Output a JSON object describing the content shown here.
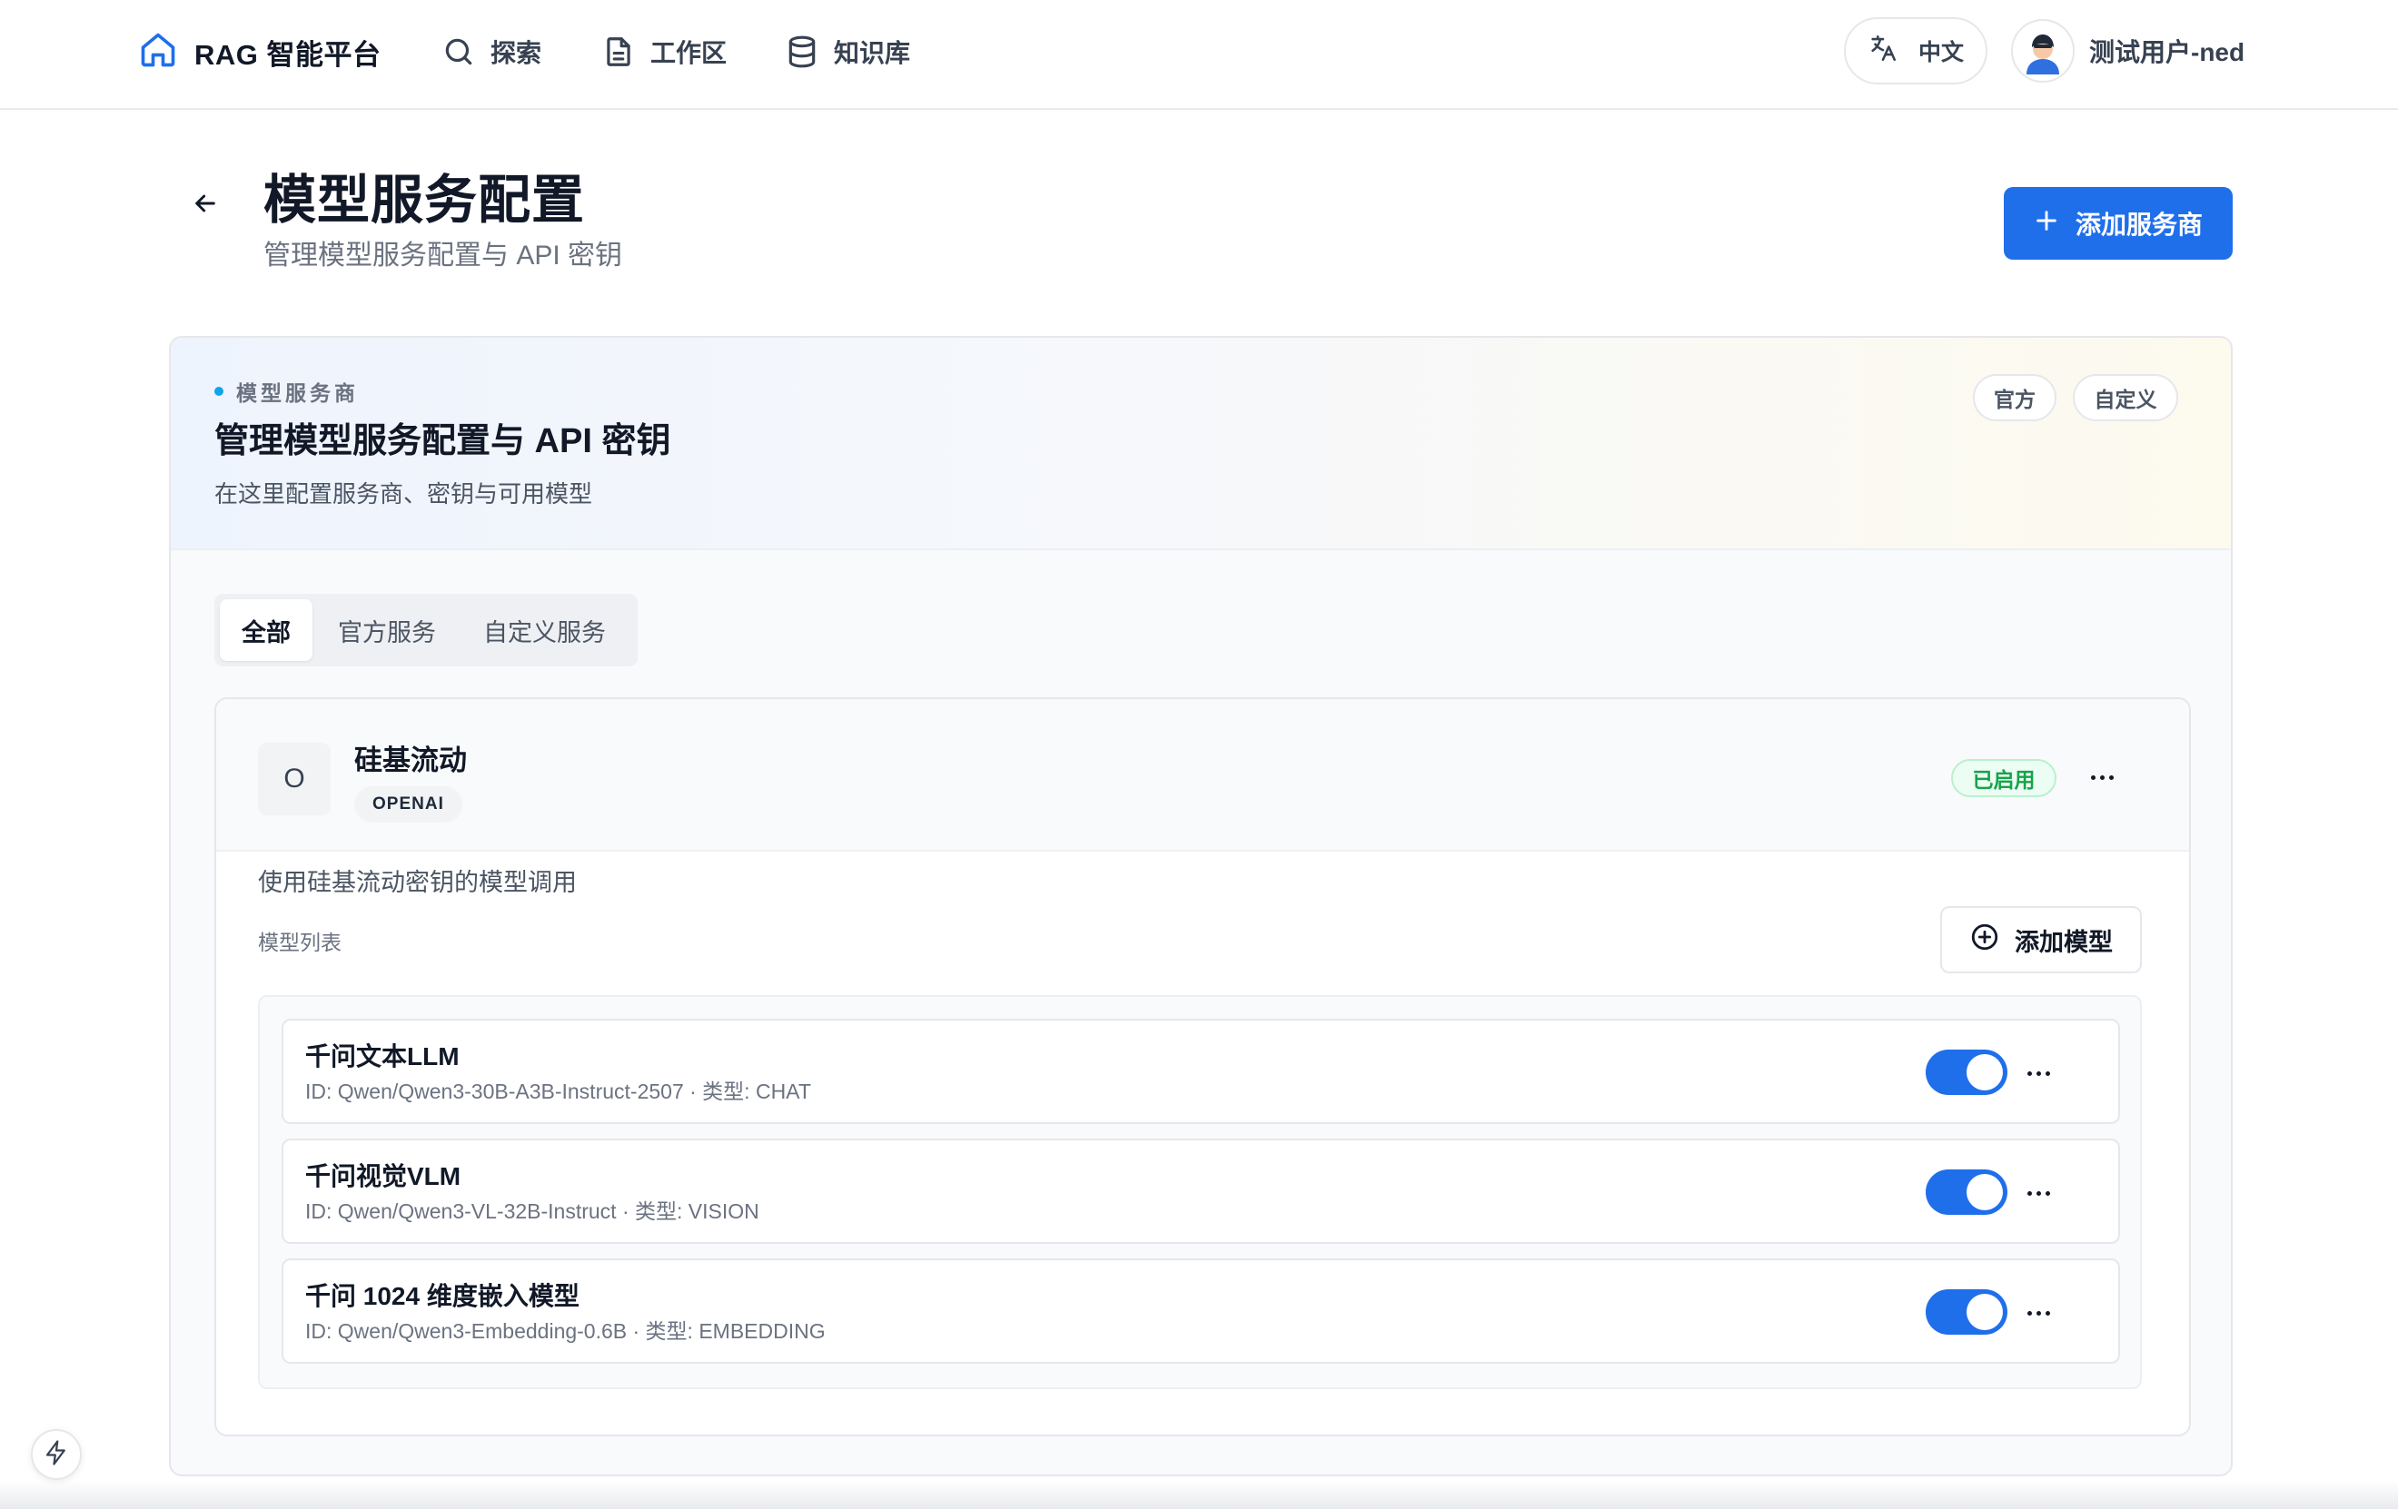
{
  "nav": {
    "brand": "RAG 智能平台",
    "items": [
      {
        "label": "探索",
        "icon": "search-icon"
      },
      {
        "label": "工作区",
        "icon": "document-icon"
      },
      {
        "label": "知识库",
        "icon": "database-icon"
      }
    ],
    "language": "中文",
    "user_name": "测试用户-ned"
  },
  "page": {
    "title": "模型服务配置",
    "subtitle": "管理模型服务配置与 API 密钥",
    "add_provider_label": "添加服务商"
  },
  "panel": {
    "eyebrow": "模型服务商",
    "title": "管理模型服务配置与 API 密钥",
    "description": "在这里配置服务商、密钥与可用模型",
    "tags": [
      "官方",
      "自定义"
    ],
    "accent_color": "#0ea5e9"
  },
  "tabs": [
    {
      "label": "全部",
      "active": true
    },
    {
      "label": "官方服务",
      "active": false
    },
    {
      "label": "自定义服务",
      "active": false
    }
  ],
  "provider": {
    "initial": "O",
    "name": "硅基流动",
    "type": "OPENAI",
    "status": "已启用",
    "status_color": "#16a34a",
    "description": "使用硅基流动密钥的模型调用",
    "models_label": "模型列表",
    "add_model_label": "添加模型",
    "models": [
      {
        "name": "千问文本LLM",
        "meta": "ID: Qwen/Qwen3-30B-A3B-Instruct-2507 · 类型: CHAT",
        "enabled": true
      },
      {
        "name": "千问视觉VLM",
        "meta": "ID: Qwen/Qwen3-VL-32B-Instruct · 类型: VISION",
        "enabled": true
      },
      {
        "name": "千问 1024 维度嵌入模型",
        "meta": "ID: Qwen/Qwen3-Embedding-0.6B · 类型: EMBEDDING",
        "enabled": true
      }
    ]
  },
  "colors": {
    "primary": "#1f6feb",
    "text": "#111827",
    "muted": "#6b7280"
  }
}
